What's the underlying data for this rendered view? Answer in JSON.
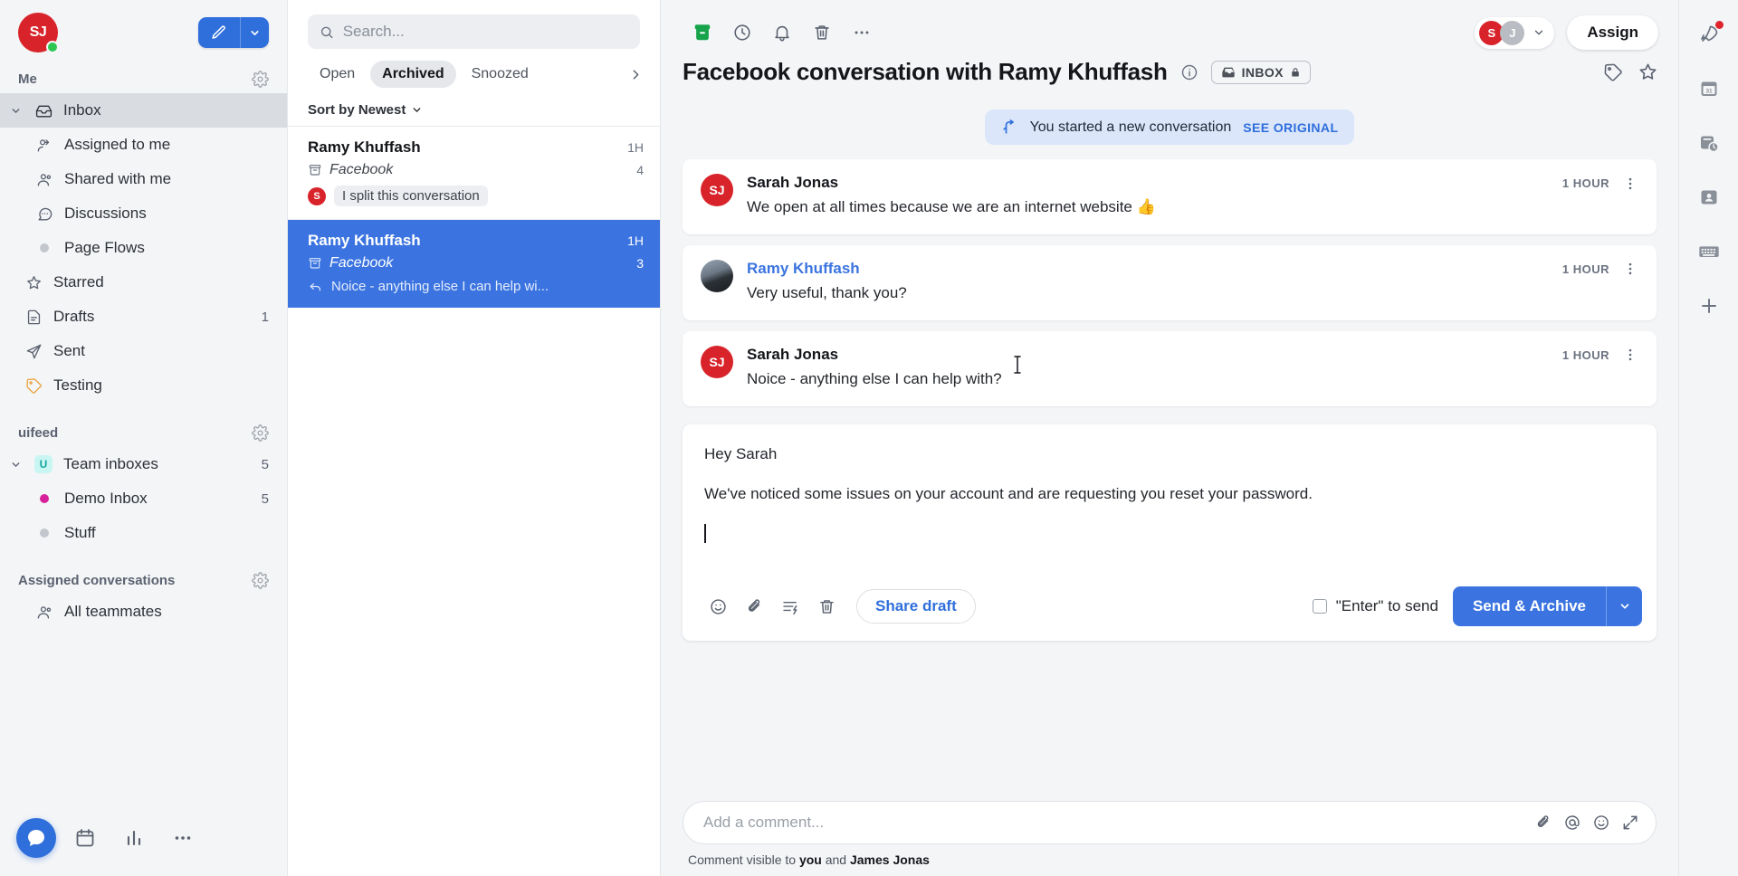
{
  "sidebar": {
    "user": {
      "initials": "SJ",
      "status_color": "#2dc653",
      "avatar_color": "#d8232a"
    },
    "compose": {
      "label": "compose-new",
      "caret": "chevron-down-icon"
    },
    "sections": [
      {
        "title": "Me",
        "gear": "settings-icon",
        "items": [
          {
            "label": "Inbox",
            "icon": "inbox-icon",
            "count": "",
            "active": true,
            "expandable": true,
            "indent": 0
          },
          {
            "label": "Assigned to me",
            "icon": "assigned-user-icon",
            "count": "",
            "indent": 1
          },
          {
            "label": "Shared with me",
            "icon": "shared-users-icon",
            "count": "",
            "indent": 1
          },
          {
            "label": "Discussions",
            "icon": "discussion-bubble-icon",
            "count": "",
            "indent": 1
          },
          {
            "label": "Page Flows",
            "icon": "dot-icon",
            "count": "",
            "indent": 1,
            "dot_color": "#c3c7cd"
          },
          {
            "label": "Starred",
            "icon": "star-icon",
            "count": "",
            "indent": 0
          },
          {
            "label": "Drafts",
            "icon": "draft-document-icon",
            "count": "1",
            "indent": 0
          },
          {
            "label": "Sent",
            "icon": "send-paper-plane-icon",
            "count": "",
            "indent": 0
          },
          {
            "label": "Testing",
            "icon": "tag-icon",
            "count": "",
            "indent": 0,
            "icon_color": "#e8a33d"
          }
        ]
      },
      {
        "title": "uifeed",
        "gear": "settings-icon",
        "items": [
          {
            "label": "Team inboxes",
            "icon": "team-logo-icon",
            "count": "5",
            "expandable": true,
            "indent": 0,
            "logo_letter": "U"
          },
          {
            "label": "Demo Inbox",
            "icon": "dot-icon",
            "count": "5",
            "indent": 1,
            "dot_color": "#d6219b"
          },
          {
            "label": "Stuff",
            "icon": "dot-icon",
            "count": "",
            "indent": 1,
            "dot_color": "#c3c7cd"
          }
        ]
      },
      {
        "title": "Assigned conversations",
        "gear": "settings-icon",
        "items": [
          {
            "label": "All teammates",
            "icon": "shared-users-icon",
            "count": "",
            "indent": 0
          }
        ]
      }
    ],
    "dock": [
      {
        "name": "messenger-bubble-button",
        "icon": "chat-bubble-icon",
        "primary": true
      },
      {
        "name": "calendar-button",
        "icon": "calendar-icon",
        "primary": false
      },
      {
        "name": "reports-button",
        "icon": "bar-chart-icon",
        "primary": false
      },
      {
        "name": "more-apps-button",
        "icon": "ellipsis-icon",
        "primary": false
      }
    ]
  },
  "conversation_list": {
    "search": {
      "placeholder": "Search...",
      "value": "",
      "icon": "search-icon"
    },
    "filters": [
      {
        "label": "Open",
        "active": false
      },
      {
        "label": "Archived",
        "active": true
      },
      {
        "label": "Snoozed",
        "active": false
      }
    ],
    "filters_more_icon": "chevron-right-icon",
    "sort": {
      "label": "Sort by Newest",
      "icon": "chevron-down-icon"
    },
    "rows": [
      {
        "name": "Ramy Khuffash",
        "time": "1H",
        "channel": "Facebook",
        "channel_icon": "archive-box-icon",
        "badge": "4",
        "snippet": "I split this conversation",
        "snippet_style": "pill",
        "snippet_avatar": "S",
        "snippet_avatar_color": "#d8232a",
        "selected": false
      },
      {
        "name": "Ramy Khuffash",
        "time": "1H",
        "channel": "Facebook",
        "channel_icon": "archive-box-icon",
        "badge": "3",
        "snippet": "Noice - anything else I can help wi...",
        "snippet_style": "reply",
        "snippet_icon": "reply-arrow-icon",
        "selected": true
      }
    ]
  },
  "main": {
    "toolbar": [
      {
        "name": "archive-button",
        "icon": "archive-icon",
        "color": "#16a34a"
      },
      {
        "name": "snooze-button",
        "icon": "clock-icon",
        "color": "#5b6270"
      },
      {
        "name": "reminder-button",
        "icon": "bell-icon",
        "color": "#5b6270"
      },
      {
        "name": "delete-button",
        "icon": "trash-icon",
        "color": "#5b6270"
      },
      {
        "name": "more-options-button",
        "icon": "ellipsis-icon",
        "color": "#5b6270"
      }
    ],
    "assignees": [
      {
        "initials": "S",
        "color": "#d8232a"
      },
      {
        "initials": "J",
        "color": "#b9bcc2"
      }
    ],
    "assign_button": "Assign",
    "title": "Facebook conversation with Ramy Khuffash",
    "info_icon": "info-circle-icon",
    "inbox_chip": {
      "label": "INBOX",
      "icon": "inbox-icon",
      "lock_icon": "lock-icon"
    },
    "title_actions": [
      {
        "name": "tag-button",
        "icon": "tag-icon"
      },
      {
        "name": "star-button",
        "icon": "star-icon"
      }
    ],
    "system_banner": {
      "icon": "split-arrow-icon",
      "text": "You started a new conversation",
      "link": "SEE ORIGINAL"
    },
    "messages": [
      {
        "author": "Sarah Jonas",
        "author_link": false,
        "avatar_type": "initials",
        "avatar_initials": "SJ",
        "avatar_color": "#d8232a",
        "time": "1 HOUR",
        "text": "We open at all times because we are an internet website 👍"
      },
      {
        "author": "Ramy Khuffash",
        "author_link": true,
        "avatar_type": "photo",
        "avatar_initials": "",
        "avatar_color": "#5b6270",
        "time": "1 HOUR",
        "text": "Very useful, thank you?"
      },
      {
        "author": "Sarah Jonas",
        "author_link": false,
        "avatar_type": "initials",
        "avatar_initials": "SJ",
        "avatar_color": "#d8232a",
        "time": "1 HOUR",
        "text": "Noice - anything else I can help with?"
      }
    ],
    "composer": {
      "line1": "Hey Sarah",
      "line2": "We've noticed some issues on your account and are requesting you reset your password.",
      "tools": [
        {
          "name": "emoji-button",
          "icon": "emoji-smiley-icon"
        },
        {
          "name": "attach-button",
          "icon": "paperclip-icon"
        },
        {
          "name": "saved-reply-button",
          "icon": "saved-reply-icon"
        },
        {
          "name": "discard-draft-button",
          "icon": "trash-icon"
        }
      ],
      "share_draft": "Share draft",
      "enter_to_send": "\"Enter\" to send",
      "enter_to_send_checked": false,
      "send_label": "Send & Archive",
      "send_caret": "chevron-down-icon"
    },
    "comment": {
      "placeholder": "Add a comment...",
      "value": "",
      "icons": [
        {
          "name": "comment-attach-button",
          "icon": "paperclip-icon"
        },
        {
          "name": "comment-mention-button",
          "icon": "at-sign-icon"
        },
        {
          "name": "comment-emoji-button",
          "icon": "emoji-smiley-icon"
        },
        {
          "name": "comment-expand-button",
          "icon": "expand-diagonal-icon"
        }
      ],
      "note_prefix": "Comment visible to ",
      "note_you": "you",
      "note_middle": " and ",
      "note_person": "James Jonas"
    }
  },
  "right_rail": [
    {
      "name": "product-tours-button",
      "icon": "rocket-icon",
      "badge": true
    },
    {
      "name": "calendar-button",
      "icon": "calendar-31-icon",
      "badge": false
    },
    {
      "name": "snippets-button",
      "icon": "saved-notes-icon",
      "badge": false
    },
    {
      "name": "contacts-button",
      "icon": "contact-card-icon",
      "badge": false
    },
    {
      "name": "shortcuts-button",
      "icon": "keyboard-icon",
      "badge": false
    },
    {
      "name": "add-app-button",
      "icon": "plus-icon",
      "badge": false
    }
  ]
}
